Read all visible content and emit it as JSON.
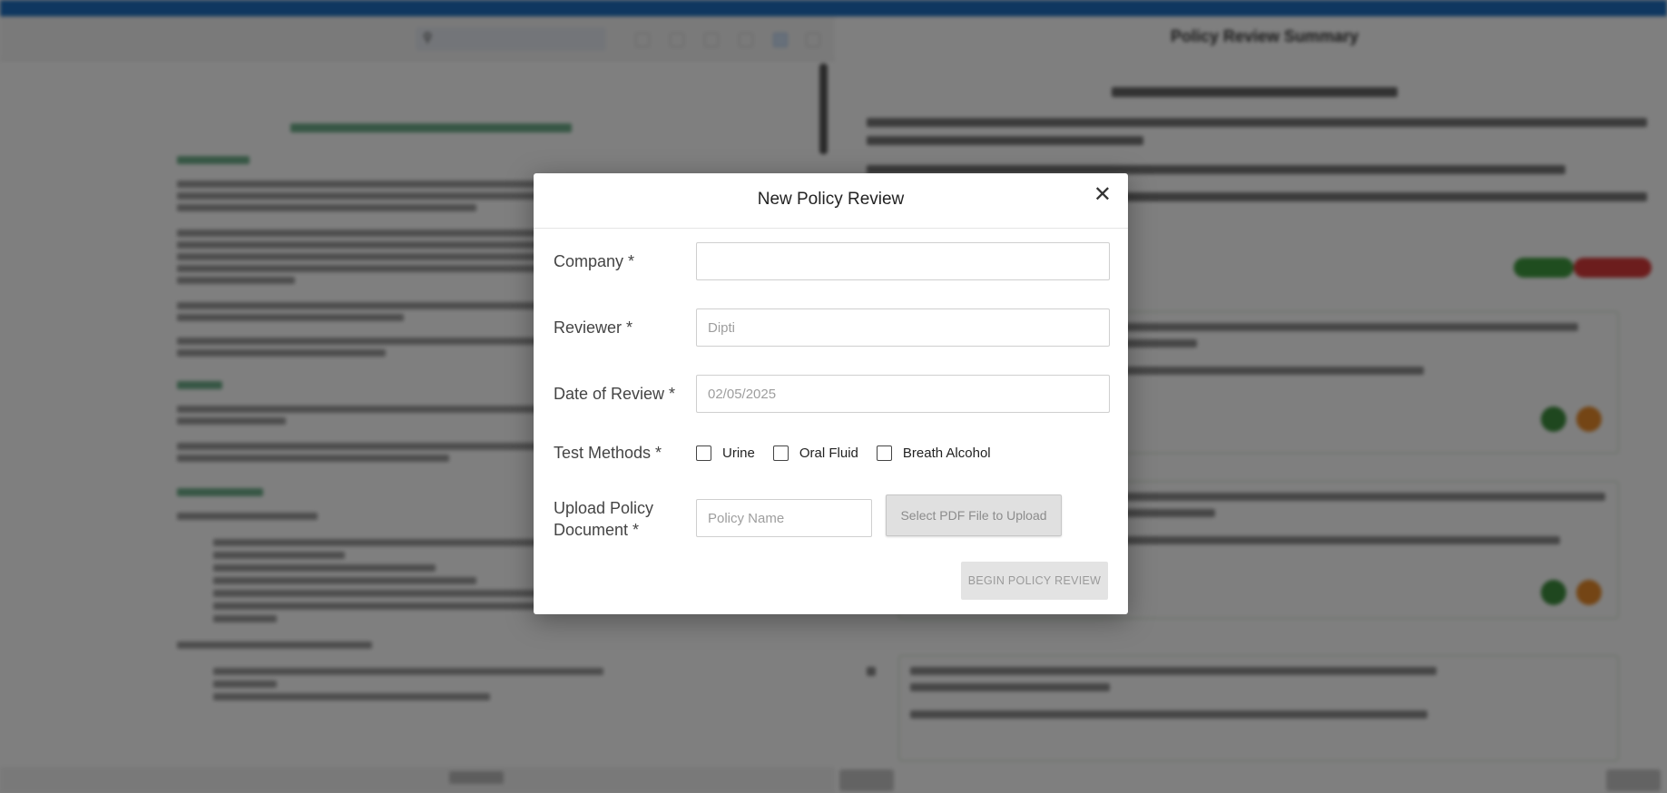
{
  "modal": {
    "title": "New Policy Review",
    "close_icon": "close-icon",
    "fields": {
      "company": {
        "label": "Company *",
        "value": "",
        "placeholder": ""
      },
      "reviewer": {
        "label": "Reviewer *",
        "value": "",
        "placeholder": "Dipti"
      },
      "date_of_review": {
        "label": "Date of Review *",
        "value": "",
        "placeholder": "02/05/2025"
      },
      "test_methods": {
        "label": "Test Methods *",
        "options": [
          {
            "label": "Urine",
            "checked": false
          },
          {
            "label": "Oral Fluid",
            "checked": false
          },
          {
            "label": "Breath Alcohol",
            "checked": false
          }
        ]
      },
      "upload": {
        "label_line1": "Upload Policy",
        "label_line2": "Document *",
        "policy_name_placeholder": "Policy Name",
        "select_button": "Select PDF File to Upload"
      }
    },
    "submit_button": "BEGIN POLICY REVIEW"
  },
  "background": {
    "search_icon": "search-icon",
    "panel_title": "Policy Review Summary",
    "colors": {
      "topbar": "#1e6fc0",
      "doc_heading": "#2e8b57",
      "pill_green": "#3f9b3f",
      "pill_red": "#d83a3a",
      "dot_green": "#3e8e3e",
      "dot_orange": "#e88a2a"
    }
  }
}
